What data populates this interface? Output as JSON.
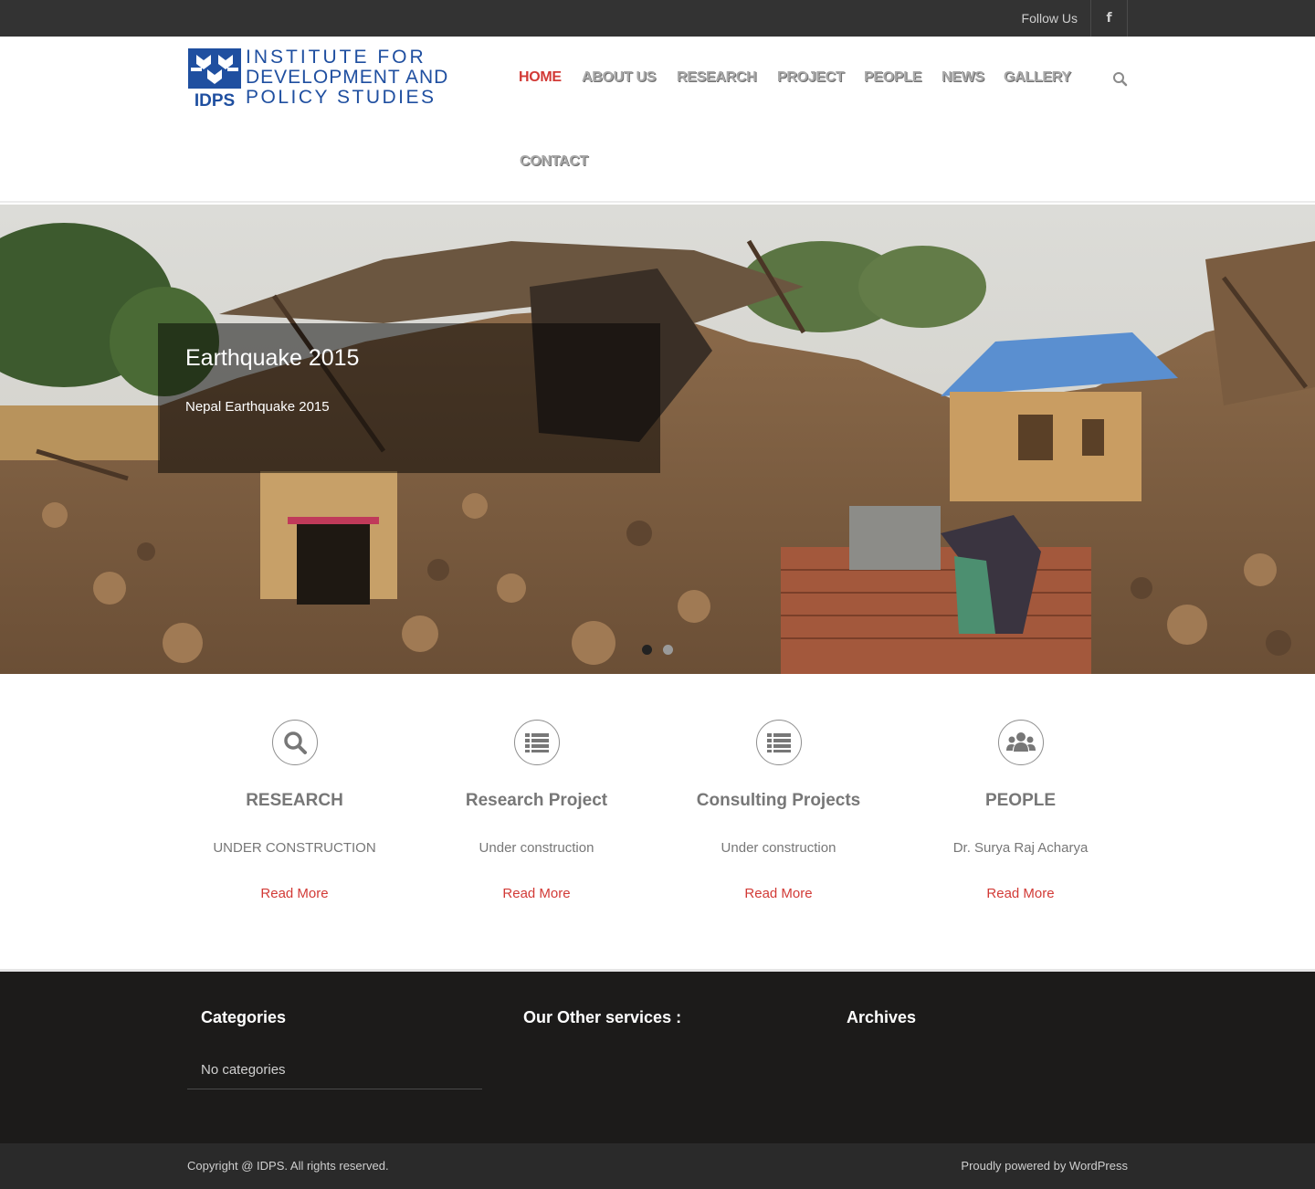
{
  "topbar": {
    "follow_label": "Follow Us",
    "facebook_glyph": "f"
  },
  "logo": {
    "mark_letters": "IDPS",
    "line1": "INSTITUTE FOR",
    "line2": "DEVELOPMENT AND",
    "line3": "POLICY STUDIES",
    "brand_color": "#1f4fa0"
  },
  "nav": {
    "items": [
      {
        "label": "HOME",
        "active": true
      },
      {
        "label": "ABOUT US"
      },
      {
        "label": "RESEARCH"
      },
      {
        "label": "PROJECT"
      },
      {
        "label": "PEOPLE"
      },
      {
        "label": "NEWS"
      },
      {
        "label": "GALLERY"
      },
      {
        "label": "CONTACT"
      }
    ],
    "active_color": "#d23a36",
    "search_icon": "search-icon"
  },
  "slider": {
    "title": "Earthquake 2015",
    "subtitle": "Nepal Earthquake 2015",
    "slide_count": 2,
    "active_slide": 1
  },
  "features": [
    {
      "icon": "search-icon",
      "title": "RESEARCH",
      "text": "UNDER CONSTRUCTION",
      "link": "Read More"
    },
    {
      "icon": "list-icon",
      "title": "Research Project",
      "text": "Under construction",
      "link": "Read More"
    },
    {
      "icon": "list-icon",
      "title": "Consulting Projects",
      "text": "Under construction",
      "link": "Read More"
    },
    {
      "icon": "users-icon",
      "title": "PEOPLE",
      "text": "Dr. Surya Raj Acharya",
      "link": "Read More"
    }
  ],
  "footer": {
    "categories_title": "Categories",
    "categories_empty": "No categories",
    "services_title": "Our Other services :",
    "archives_title": "Archives"
  },
  "bottom": {
    "copyright": "Copyright @ IDPS. All rights reserved.",
    "powered": "Proudly powered by WordPress"
  },
  "colors": {
    "accent": "#d23a36",
    "topbar": "#333333",
    "footer": "#1c1b1a"
  }
}
